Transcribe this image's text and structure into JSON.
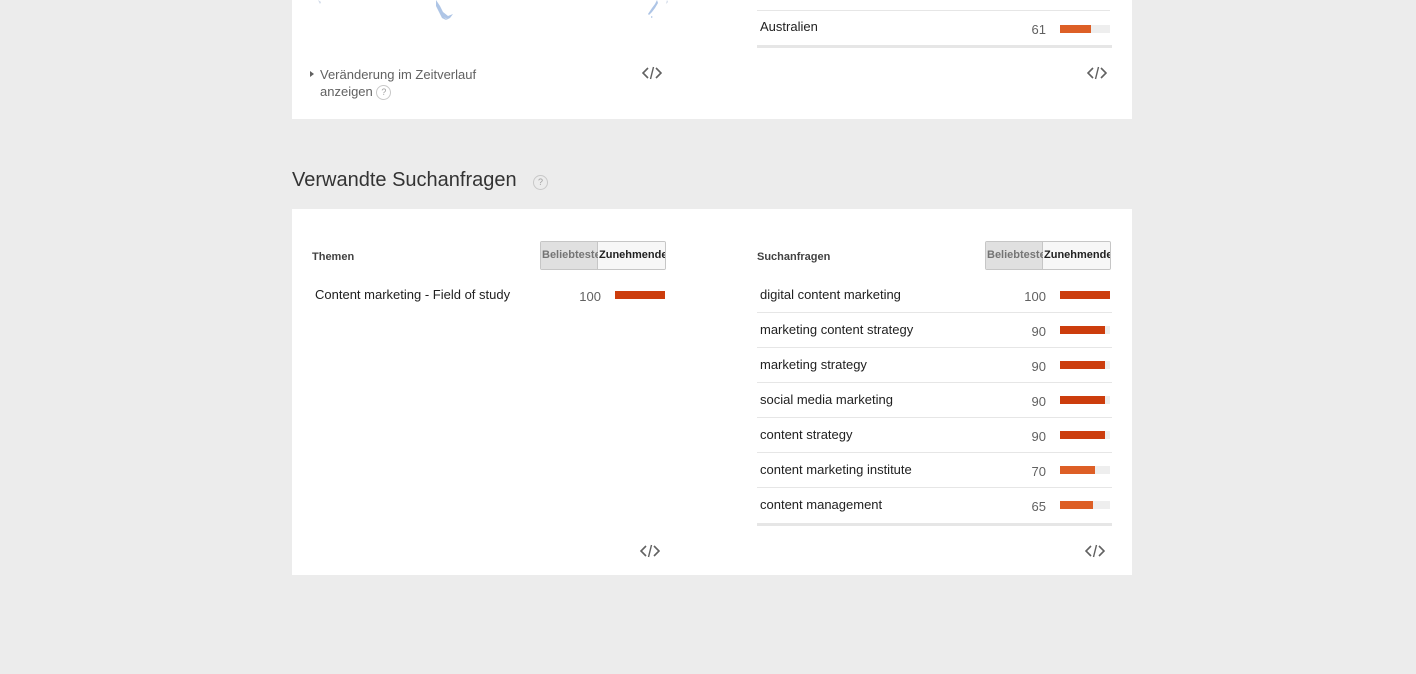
{
  "colors": {
    "page_background": "#ececec",
    "card_background": "#ffffff",
    "bar_strong": "#cc3d0d",
    "bar_medium": "#dd5f26",
    "bar_track": "#eeeeee",
    "map_land": "#aec5e6"
  },
  "region_section": {
    "rows": [
      {
        "label": "Australien",
        "value": 61,
        "fraction": 0.61
      }
    ],
    "change_toggle_label": "Veränderung im Zeitverlauf anzeigen",
    "help_glyph": "?",
    "embed_icon": "code-embed-icon"
  },
  "related": {
    "title": "Verwandte Suchanfragen",
    "help_glyph": "?",
    "topics": {
      "heading": "Themen",
      "tabs": [
        "Beliebteste",
        "Zunehmende"
      ],
      "rows": [
        {
          "label": "Content marketing - Field of study",
          "value": 100,
          "fraction": 1.0
        }
      ]
    },
    "queries": {
      "heading": "Suchanfragen",
      "tabs": [
        "Beliebteste",
        "Zunehmende"
      ],
      "rows": [
        {
          "label": "digital content marketing",
          "value": 100,
          "fraction": 1.0
        },
        {
          "label": "marketing content strategy",
          "value": 90,
          "fraction": 0.9
        },
        {
          "label": "marketing strategy",
          "value": 90,
          "fraction": 0.9
        },
        {
          "label": "social media marketing",
          "value": 90,
          "fraction": 0.9
        },
        {
          "label": "content strategy",
          "value": 90,
          "fraction": 0.9
        },
        {
          "label": "content marketing institute",
          "value": 70,
          "fraction": 0.7
        },
        {
          "label": "content management",
          "value": 65,
          "fraction": 0.65
        }
      ]
    }
  }
}
